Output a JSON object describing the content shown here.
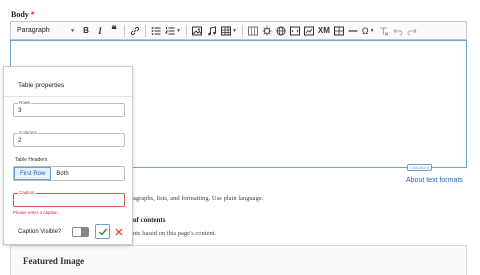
{
  "field": {
    "label": "Body",
    "required_mark": "*"
  },
  "toolbar": {
    "format_value": "Paragraph",
    "omega_symbol": "Ω",
    "xml_label": "XM"
  },
  "powered_by": "CKEditor 5",
  "about_link": "About text formats",
  "help_text": "agraphs, lists, and formatting. Use plain language.",
  "toc": {
    "label": "of contents",
    "description": "nts based on this page's content."
  },
  "featured_image": {
    "title": "Featured Image"
  },
  "popup": {
    "title": "Table properties",
    "rows": {
      "label": "Rows",
      "value": "3"
    },
    "columns": {
      "label": "Columns",
      "value": "2"
    },
    "headers_label": "Table Headers",
    "header_options": [
      "First Row",
      "Both"
    ],
    "selected_header": "First Row",
    "caption": {
      "label": "Caption",
      "value": "",
      "error": "Please enter a caption."
    },
    "caption_visible_label": "Caption Visible?"
  },
  "colors": {
    "accent": "#2a64b2",
    "error": "#d9534f",
    "focus_border": "#6e9fd5",
    "ok_check": "#2e8b3d",
    "cancel_x": "#d33"
  }
}
